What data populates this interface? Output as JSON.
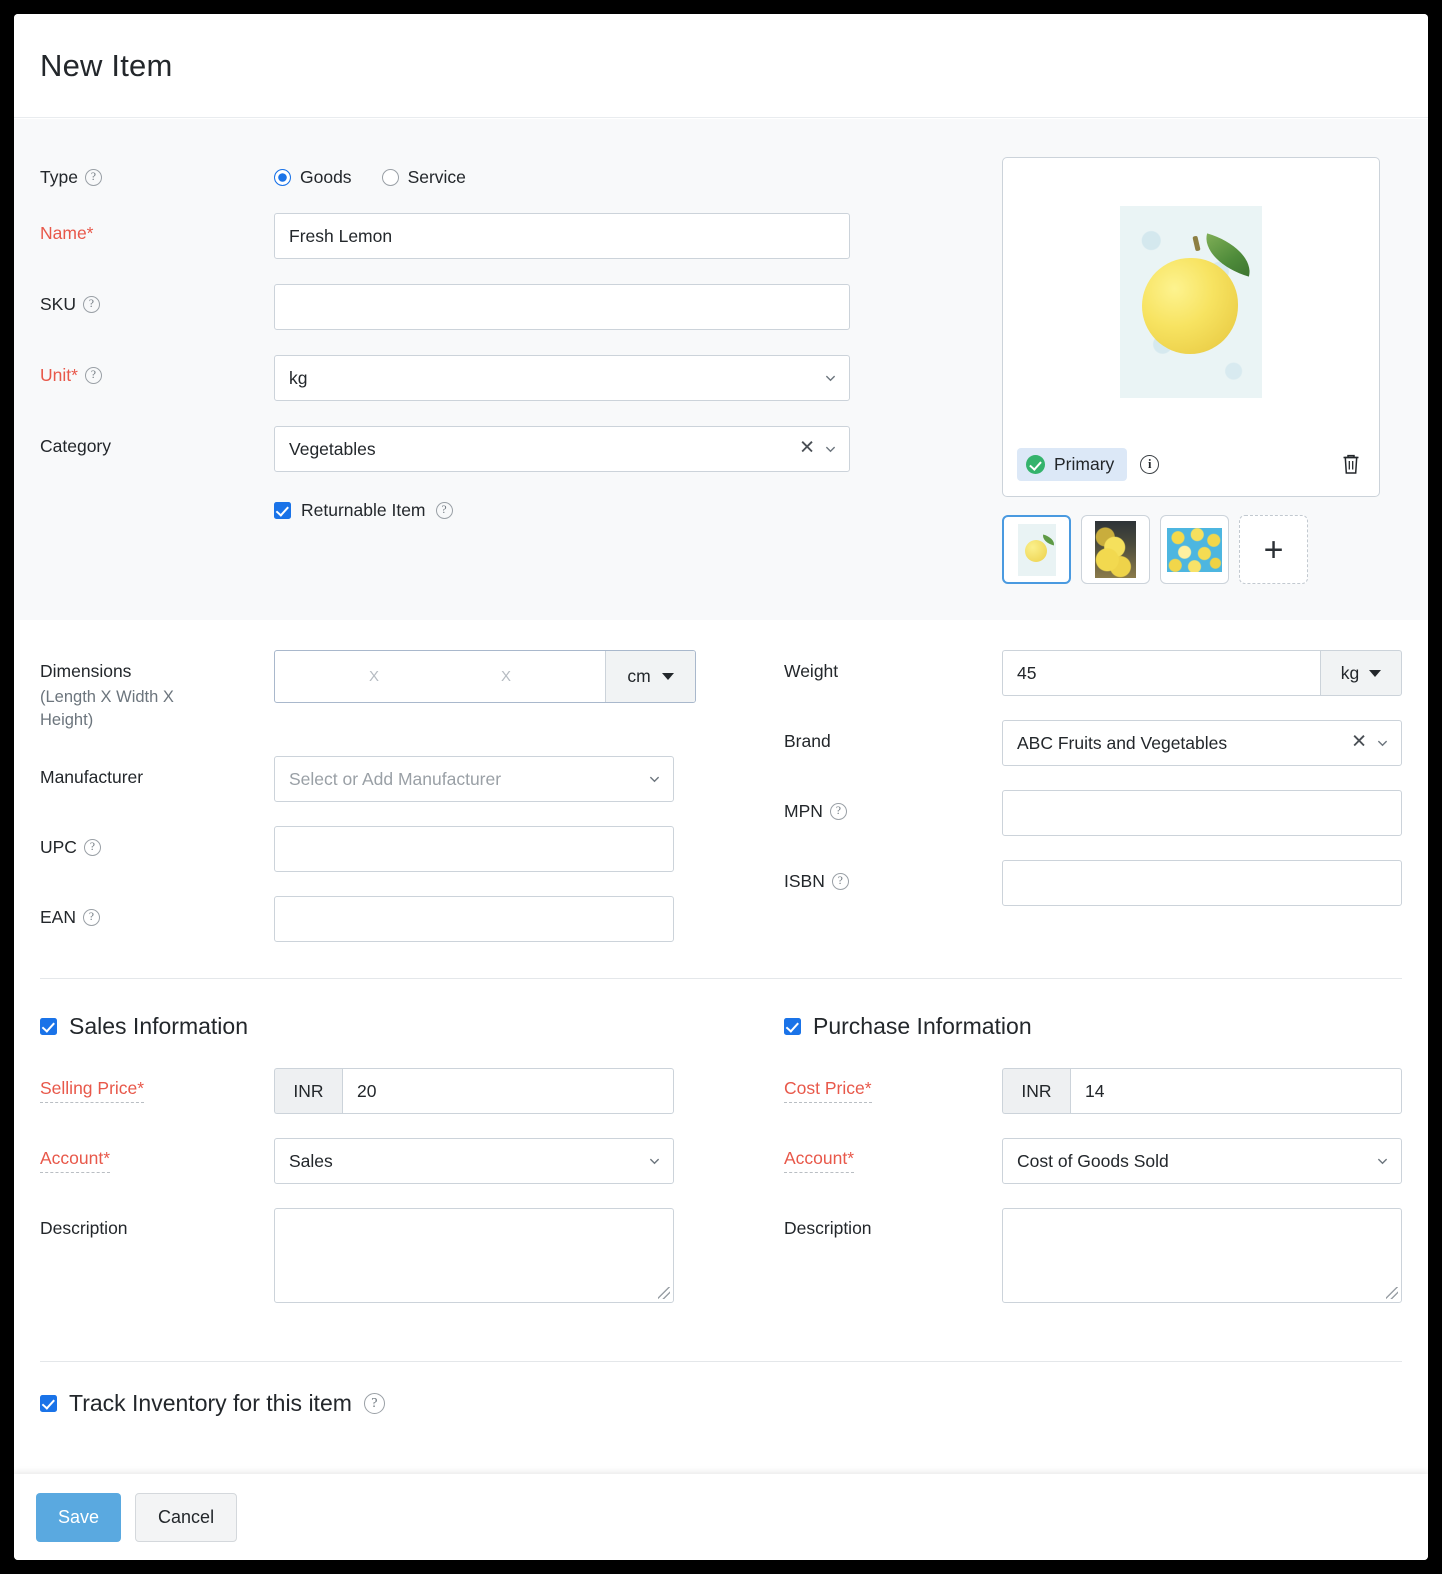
{
  "header": {
    "title": "New Item"
  },
  "basic": {
    "type": {
      "label": "Type",
      "options": [
        "Goods",
        "Service"
      ],
      "selected": "Goods"
    },
    "name": {
      "label": "Name*",
      "value": "Fresh Lemon"
    },
    "sku": {
      "label": "SKU",
      "value": ""
    },
    "unit": {
      "label": "Unit*",
      "value": "kg"
    },
    "category": {
      "label": "Category",
      "value": "Vegetables"
    },
    "returnable": {
      "label": "Returnable Item",
      "checked": true
    }
  },
  "image_panel": {
    "primary_badge": "Primary",
    "info_icon": "info-icon",
    "delete_icon": "trash-icon",
    "add_label": "+",
    "thumb_count": 3
  },
  "details": {
    "dimensions": {
      "label": "Dimensions",
      "sublabel": "(Length X Width X Height)",
      "length": "",
      "width": "",
      "height": "",
      "separator": "X",
      "unit": "cm"
    },
    "weight": {
      "label": "Weight",
      "value": "45",
      "unit": "kg"
    },
    "manufacturer": {
      "label": "Manufacturer",
      "placeholder": "Select or Add Manufacturer",
      "value": ""
    },
    "brand": {
      "label": "Brand",
      "value": "ABC Fruits and Vegetables"
    },
    "upc": {
      "label": "UPC",
      "value": ""
    },
    "mpn": {
      "label": "MPN",
      "value": ""
    },
    "ean": {
      "label": "EAN",
      "value": ""
    },
    "isbn": {
      "label": "ISBN",
      "value": ""
    }
  },
  "sales": {
    "heading": "Sales Information",
    "checked": true,
    "price": {
      "label": "Selling Price*",
      "currency": "INR",
      "value": "20"
    },
    "account": {
      "label": "Account*",
      "value": "Sales"
    },
    "description": {
      "label": "Description",
      "value": ""
    }
  },
  "purchase": {
    "heading": "Purchase Information",
    "checked": true,
    "price": {
      "label": "Cost Price*",
      "currency": "INR",
      "value": "14"
    },
    "account": {
      "label": "Account*",
      "value": "Cost of Goods Sold"
    },
    "description": {
      "label": "Description",
      "value": ""
    }
  },
  "inventory": {
    "heading": "Track Inventory for this item",
    "checked": true
  },
  "footer": {
    "save": "Save",
    "cancel": "Cancel"
  },
  "colors": {
    "required": "#e8584a",
    "accent_blue": "#1a73e8",
    "save_blue": "#5aa9e0",
    "badge_green": "#34b36c",
    "section_bg": "#f8f9fa"
  }
}
